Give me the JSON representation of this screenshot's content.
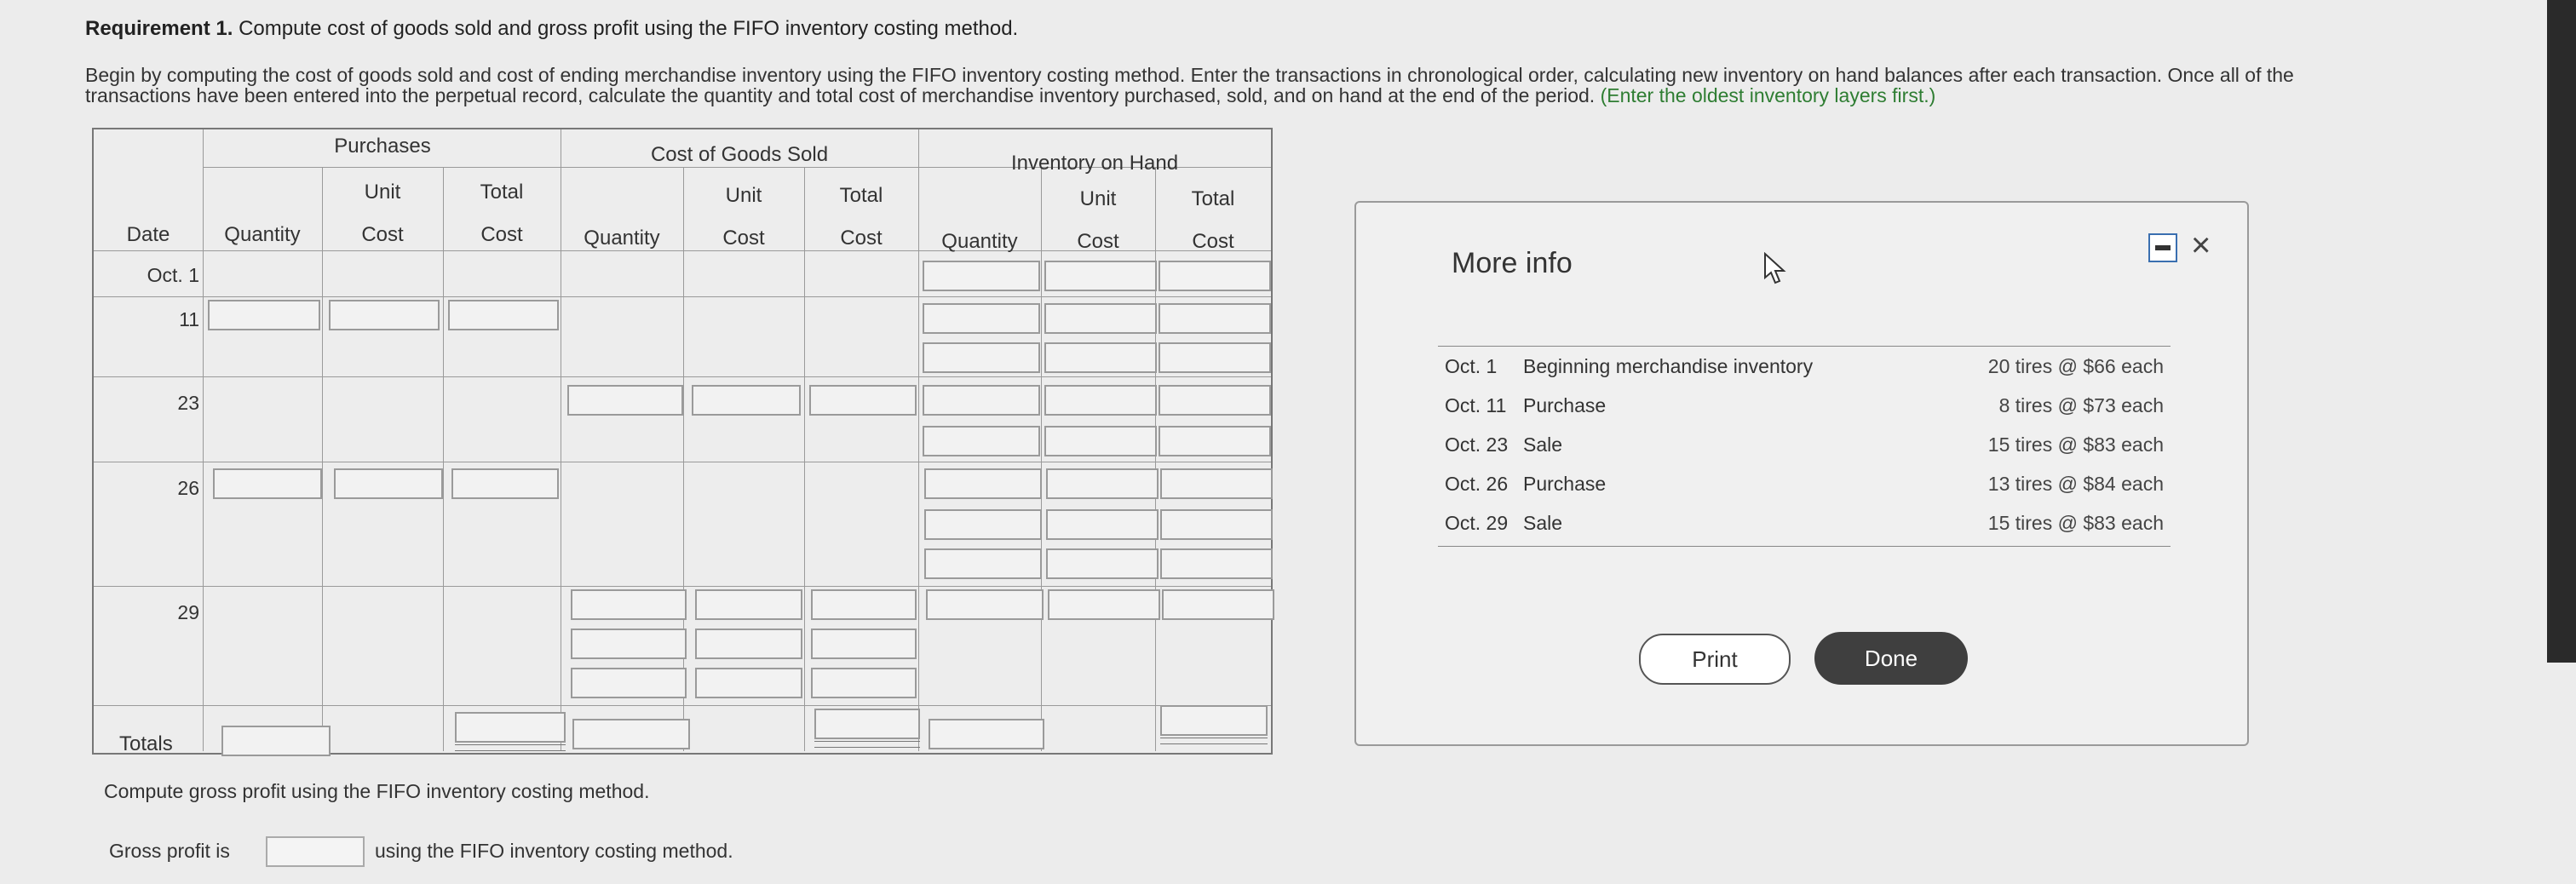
{
  "requirement": {
    "label": "Requirement 1.",
    "text": "Compute cost of goods sold and gross profit using the FIFO inventory costing method."
  },
  "intro": {
    "line1": "Begin by computing the cost of goods sold and cost of ending merchandise inventory using the FIFO inventory costing method. Enter the transactions in chronological order, calculating new inventory on hand balances after each transaction. Once all of the",
    "line2": "transactions have been entered into the perpetual record, calculate the quantity and total cost of merchandise inventory purchased, sold, and on hand at the end of the period.",
    "hint": "(Enter the oldest inventory layers first.)"
  },
  "table": {
    "group_purchases": "Purchases",
    "group_cogs": "Cost of Goods Sold",
    "group_inventory": "Inventory on Hand",
    "col_date": "Date",
    "col_quantity": "Quantity",
    "col_unit": "Unit",
    "col_cost": "Cost",
    "col_total": "Total",
    "dates": [
      "Oct. 1",
      "11",
      "23",
      "26",
      "29"
    ],
    "totals_label": "Totals"
  },
  "gross_profit": {
    "prompt": "Compute gross profit using the FIFO inventory costing method.",
    "label": "Gross profit is",
    "value": "",
    "suffix": "using the FIFO inventory costing method."
  },
  "dialog": {
    "title": "More info",
    "rows": [
      {
        "date": "Oct. 1",
        "event": "Beginning merchandise inventory",
        "amount": "20 tires @ $66 each"
      },
      {
        "date": "Oct. 11",
        "event": "Purchase",
        "amount": "8 tires @ $73 each"
      },
      {
        "date": "Oct. 23",
        "event": "Sale",
        "amount": "15 tires @ $83 each"
      },
      {
        "date": "Oct. 26",
        "event": "Purchase",
        "amount": "13 tires @ $84 each"
      },
      {
        "date": "Oct. 29",
        "event": "Sale",
        "amount": "15 tires @ $83 each"
      }
    ],
    "print_label": "Print",
    "done_label": "Done",
    "close_glyph": "×"
  },
  "icons": {
    "minimize": "minimize-icon",
    "close": "close-icon",
    "cursor": "cursor-icon"
  }
}
